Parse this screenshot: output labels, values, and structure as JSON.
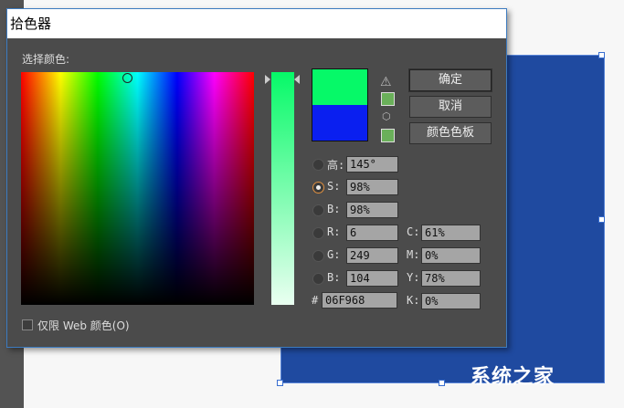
{
  "dialog": {
    "title": "拾色器",
    "select_label": "选择颜色:",
    "web_only_label": "仅限 Web 颜色(O)",
    "buttons": {
      "ok": "确定",
      "cancel": "取消",
      "swatches": "颜色色板"
    },
    "new_color": "#06f968",
    "old_color": "#0a1ff0",
    "fields": [
      {
        "label": "高:",
        "value": "145°",
        "selected": false
      },
      {
        "label": "S:",
        "value": "98%",
        "selected": true
      },
      {
        "label": "B:",
        "value": "98%",
        "selected": false
      },
      {
        "label": "R:",
        "value": "6",
        "selected": false
      },
      {
        "label": "G:",
        "value": "249",
        "selected": false
      },
      {
        "label": "B:",
        "value": "104",
        "selected": false
      }
    ],
    "cmyk": [
      {
        "label": "C:",
        "value": "61%"
      },
      {
        "label": "M:",
        "value": "0%"
      },
      {
        "label": "Y:",
        "value": "78%"
      },
      {
        "label": "K:",
        "value": "0%"
      }
    ],
    "hex_label": "#",
    "hex": "06F968"
  },
  "watermark": "系统之家"
}
